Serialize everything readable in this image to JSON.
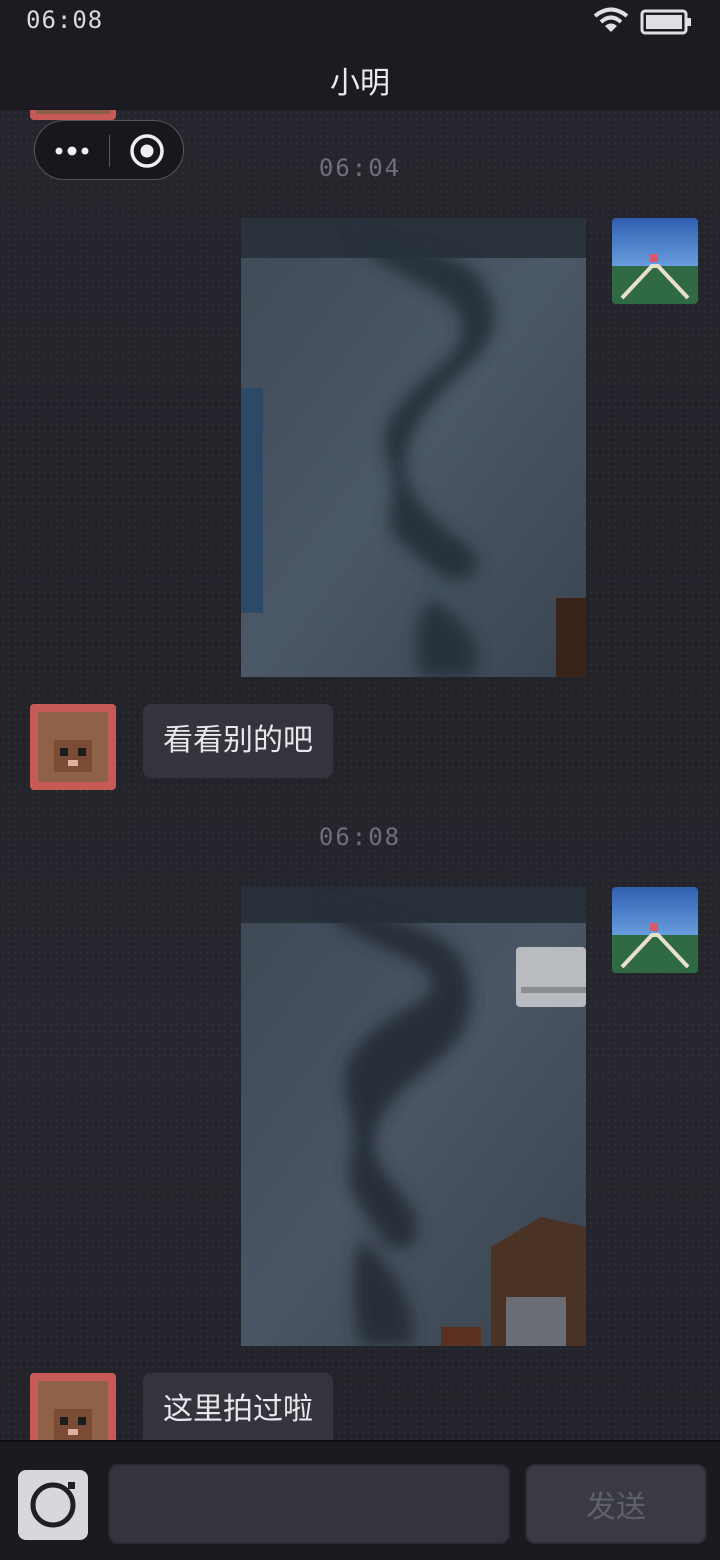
{
  "status": {
    "time": "06:08"
  },
  "nav": {
    "title": "小明"
  },
  "capsule": {
    "more_icon": "more-dots-icon",
    "close_icon": "target-circle-icon"
  },
  "messages": [
    {
      "type": "time",
      "text": "06:04"
    },
    {
      "type": "image",
      "from": "self",
      "content": "photo of a shadow on a wall"
    },
    {
      "type": "text",
      "from": "other",
      "text": "看看别的吧"
    },
    {
      "type": "time",
      "text": "06:08"
    },
    {
      "type": "image",
      "from": "self",
      "content": "photo of a shadow on a wall with air conditioner"
    },
    {
      "type": "text",
      "from": "other",
      "text": "这里拍过啦"
    }
  ],
  "input": {
    "placeholder": "",
    "value": "",
    "send_label": "发送",
    "camera_icon": "camera-icon"
  },
  "colors": {
    "background": "#1f2027",
    "bubble": "#33343c",
    "bar": "#1b1b21"
  }
}
